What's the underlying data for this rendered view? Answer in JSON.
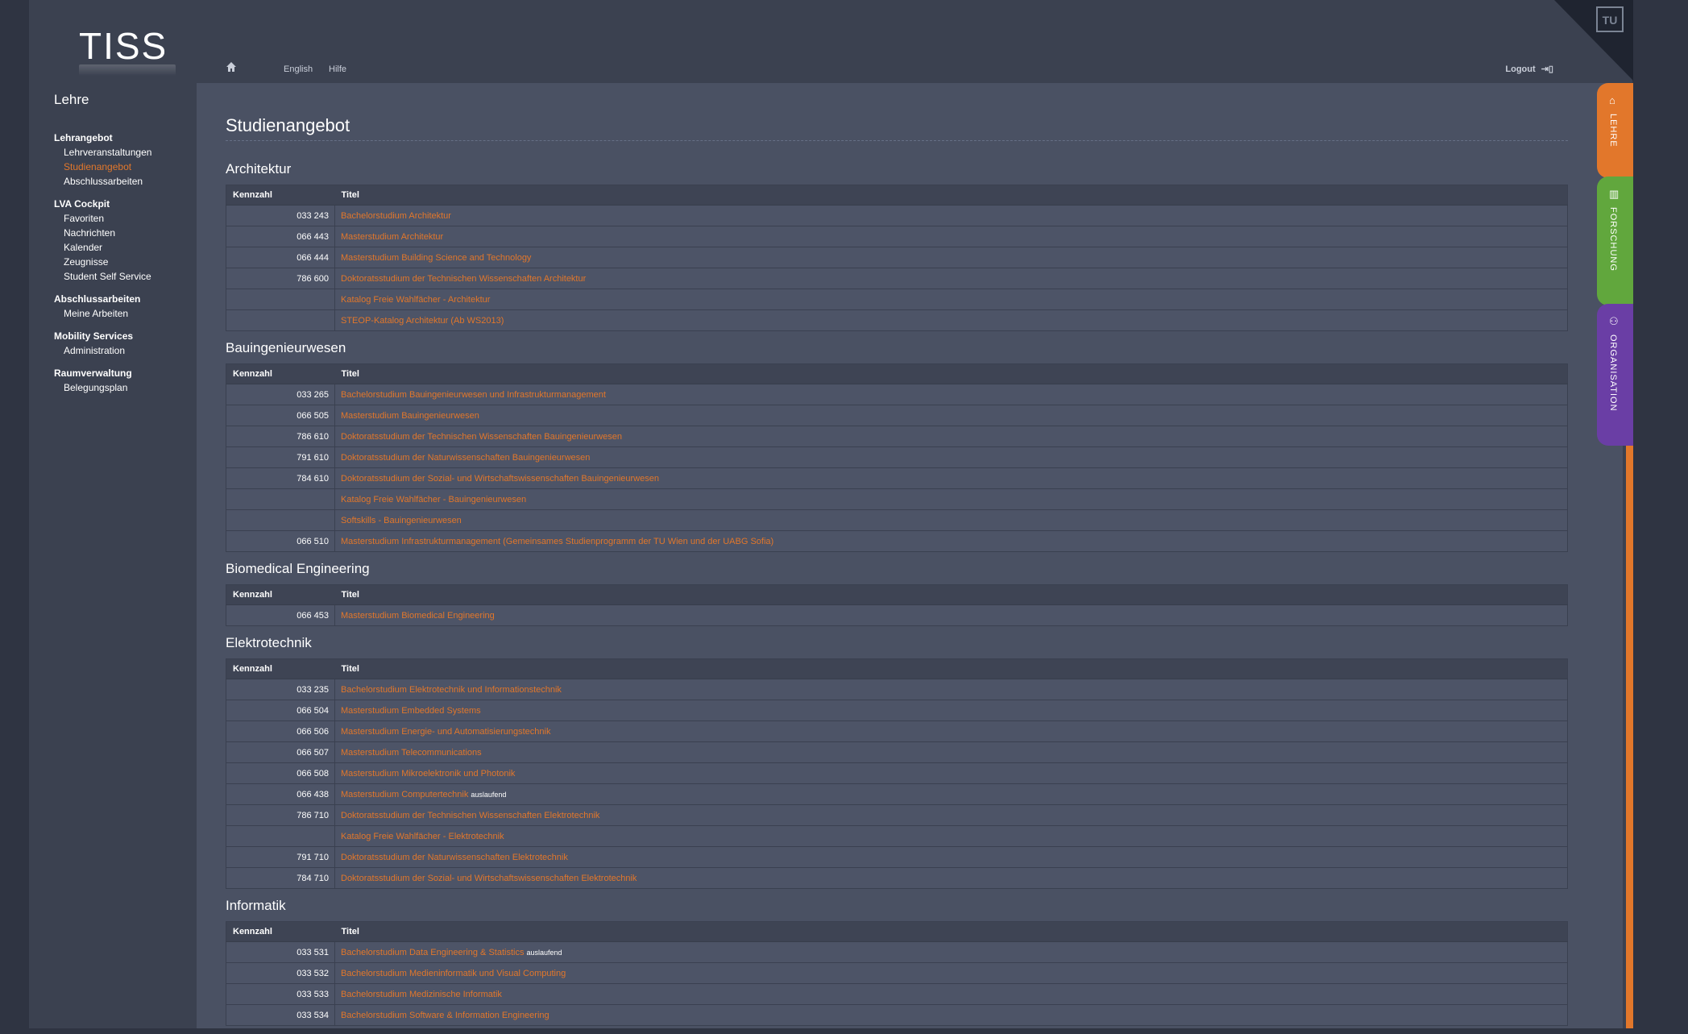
{
  "app": {
    "logo": "TISS",
    "section": "Lehre"
  },
  "topbar": {
    "home_icon": "home-icon",
    "lang": "English",
    "help": "Hilfe",
    "logout": "Logout",
    "logout_icon": "logout-icon"
  },
  "sidebar": {
    "groups": [
      {
        "heading": "Lehrangebot",
        "items": [
          "Lehrveranstaltungen",
          "Studienangebot",
          "Abschlussarbeiten"
        ]
      },
      {
        "heading": "LVA Cockpit",
        "items": [
          "Favoriten",
          "Nachrichten",
          "Kalender",
          "Zeugnisse",
          "Student Self Service"
        ]
      },
      {
        "heading": "Abschlussarbeiten",
        "items": [
          "Meine Arbeiten"
        ]
      },
      {
        "heading": "Mobility Services",
        "items": [
          "Administration"
        ]
      },
      {
        "heading": "Raumverwaltung",
        "items": [
          "Belegungsplan"
        ]
      }
    ],
    "active_item": "Studienangebot"
  },
  "main": {
    "title": "Studienangebot",
    "columns": {
      "num": "Kennzahl",
      "title": "Titel"
    },
    "sections": [
      {
        "name": "Architektur",
        "rows": [
          {
            "num": "033 243",
            "title": "Bachelorstudium Architektur"
          },
          {
            "num": "066 443",
            "title": "Masterstudium Architektur"
          },
          {
            "num": "066 444",
            "title": "Masterstudium Building Science and Technology"
          },
          {
            "num": "786 600",
            "title": "Doktoratsstudium der Technischen Wissenschaften Architektur"
          },
          {
            "num": "",
            "title": "Katalog Freie Wahlfächer - Architektur"
          },
          {
            "num": "",
            "title": "STEOP-Katalog Architektur (Ab WS2013)"
          }
        ]
      },
      {
        "name": "Bauingenieurwesen",
        "rows": [
          {
            "num": "033 265",
            "title": "Bachelorstudium Bauingenieurwesen und Infrastrukturmanagement"
          },
          {
            "num": "066 505",
            "title": "Masterstudium Bauingenieurwesen"
          },
          {
            "num": "786 610",
            "title": "Doktoratsstudium der Technischen Wissenschaften Bauingenieurwesen"
          },
          {
            "num": "791 610",
            "title": "Doktoratsstudium der Naturwissenschaften Bauingenieurwesen"
          },
          {
            "num": "784 610",
            "title": "Doktoratsstudium der Sozial- und Wirtschaftswissenschaften Bauingenieurwesen"
          },
          {
            "num": "",
            "title": "Katalog Freie Wahlfächer - Bauingenieurwesen"
          },
          {
            "num": "",
            "title": "Softskills - Bauingenieurwesen"
          },
          {
            "num": "066 510",
            "title": "Masterstudium Infrastrukturmanagement (Gemeinsames Studienprogramm der TU Wien und der UABG Sofia)"
          }
        ]
      },
      {
        "name": "Biomedical Engineering",
        "rows": [
          {
            "num": "066 453",
            "title": "Masterstudium Biomedical Engineering"
          }
        ]
      },
      {
        "name": "Elektrotechnik",
        "rows": [
          {
            "num": "033 235",
            "title": "Bachelorstudium Elektrotechnik und Informationstechnik"
          },
          {
            "num": "066 504",
            "title": "Masterstudium Embedded Systems"
          },
          {
            "num": "066 506",
            "title": "Masterstudium Energie- und Automatisierungstechnik"
          },
          {
            "num": "066 507",
            "title": "Masterstudium Telecommunications"
          },
          {
            "num": "066 508",
            "title": "Masterstudium Mikroelektronik und Photonik"
          },
          {
            "num": "066 438",
            "title": "Masterstudium Computertechnik",
            "badge": "auslaufend"
          },
          {
            "num": "786 710",
            "title": "Doktoratsstudium der Technischen Wissenschaften Elektrotechnik"
          },
          {
            "num": "",
            "title": "Katalog Freie Wahlfächer - Elektrotechnik"
          },
          {
            "num": "791 710",
            "title": "Doktoratsstudium der Naturwissenschaften Elektrotechnik"
          },
          {
            "num": "784 710",
            "title": "Doktoratsstudium der Sozial- und Wirtschaftswissenschaften Elektrotechnik"
          }
        ]
      },
      {
        "name": "Informatik",
        "rows": [
          {
            "num": "033 531",
            "title": "Bachelorstudium Data Engineering & Statistics",
            "badge": "auslaufend"
          },
          {
            "num": "033 532",
            "title": "Bachelorstudium Medieninformatik und Visual Computing"
          },
          {
            "num": "033 533",
            "title": "Bachelorstudium Medizinische Informatik"
          },
          {
            "num": "033 534",
            "title": "Bachelorstudium Software & Information Engineering"
          }
        ]
      }
    ]
  },
  "side_tabs": [
    {
      "label": "LEHRE",
      "icon": "graduation-cap-icon",
      "color": "#e2772b"
    },
    {
      "label": "FORSCHUNG",
      "icon": "building-icon",
      "color": "#61a73d"
    },
    {
      "label": "ORGANISATION",
      "icon": "people-icon",
      "color": "#6a3ea5"
    }
  ],
  "corner_logo": "TU"
}
